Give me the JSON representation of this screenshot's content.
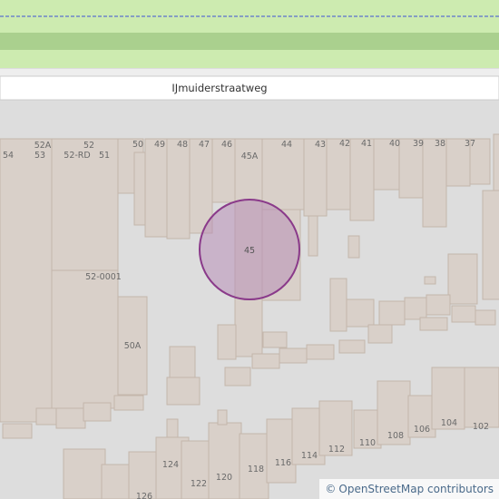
{
  "map": {
    "street_name": "IJmuiderstraatweg",
    "selected_house_number": "45",
    "colors": {
      "background": "#dddddd",
      "grass": "#cdebb0",
      "grass_dark": "#aad08e",
      "road": "#ffffff",
      "building": "#d9d0c9",
      "building_outline": "#c4b6ab",
      "marker_fill": "#b58ab6",
      "marker_stroke": "#8a3a8a"
    },
    "house_numbers": [
      "54",
      "52A",
      "53",
      "52",
      "52-RD",
      "51",
      "50",
      "49",
      "48",
      "47",
      "46",
      "45A",
      "44",
      "43",
      "42",
      "41",
      "40",
      "39",
      "38",
      "37",
      "45",
      "52-0001",
      "50A",
      "126",
      "124",
      "122",
      "120",
      "118",
      "116",
      "114",
      "112",
      "110",
      "108",
      "106",
      "104",
      "102"
    ]
  },
  "attribution": {
    "copyright_symbol": "©",
    "text": "OpenStreetMap contributors"
  }
}
